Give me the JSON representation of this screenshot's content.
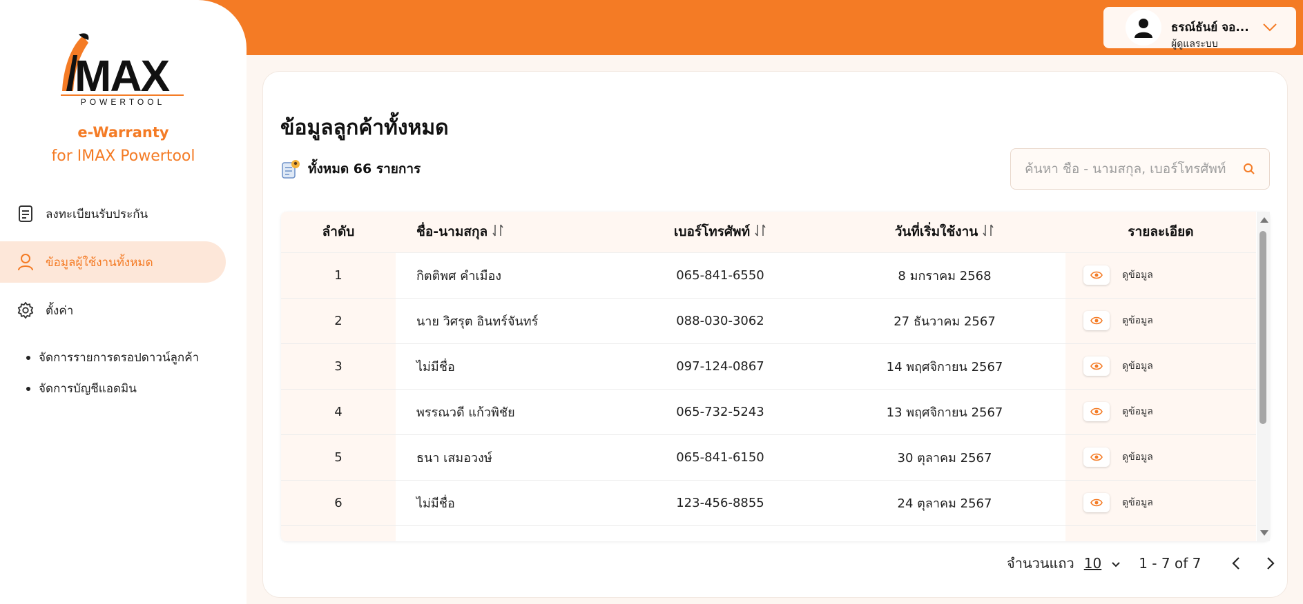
{
  "brand": {
    "logo_text": "IMAX",
    "logo_sub": "POWERTOOL",
    "title": "e-Warranty",
    "subtitle": "for IMAX Powertool"
  },
  "sidebar": {
    "items": [
      {
        "label": "ลงทะเบียนรับประกัน",
        "icon": "document-icon",
        "active": false
      },
      {
        "label": "ข้อมูลผู้ใช้งานทั้งหมด",
        "icon": "user-icon",
        "active": true
      },
      {
        "label": "ตั้งค่า",
        "icon": "gear-icon",
        "active": false
      }
    ],
    "sub_items": [
      "จัดการรายการดรอปดาวน์ลูกค้า",
      "จัดการบัญชีแอดมิน"
    ]
  },
  "user": {
    "name": "ธรณ์ธันย์ จอ...",
    "role": "ผู้ดูแลระบบ"
  },
  "page": {
    "title": "ข้อมูลลูกค้าทั้งหมด",
    "count_text": "ทั้งหมด 66 รายการ"
  },
  "search": {
    "placeholder": "ค้นหา ชื่อ - นามสกุล, เบอร์โทรศัพท์"
  },
  "table": {
    "headers": {
      "index": "ลำดับ",
      "name": "ชื่อ-นามสกุล",
      "phone": "เบอร์โทรศัพท์",
      "date": "วันที่เริ่มใช้งาน",
      "detail": "รายละเอียด"
    },
    "view_label": "ดูข้อมูล",
    "rows": [
      {
        "index": "1",
        "name": "กิตติพศ คำเมือง",
        "phone": "065-841-6550",
        "date": "8 มกราคม 2568"
      },
      {
        "index": "2",
        "name": "นาย วิศรุต อินทร์จันทร์",
        "phone": "088-030-3062",
        "date": "27 ธันวาคม 2567"
      },
      {
        "index": "3",
        "name": "ไม่มีชื่อ",
        "phone": "097-124-0867",
        "date": "14 พฤศจิกายน 2567"
      },
      {
        "index": "4",
        "name": "พรรณวดี แก้วพิชัย",
        "phone": "065-732-5243",
        "date": "13 พฤศจิกายน 2567"
      },
      {
        "index": "5",
        "name": "ธนา เสมอวงษ์",
        "phone": "065-841-6150",
        "date": "30 ตุลาคม 2567"
      },
      {
        "index": "6",
        "name": "ไม่มีชื่อ",
        "phone": "123-456-8855",
        "date": "24 ตุลาคม 2567"
      }
    ]
  },
  "pagination": {
    "rows_label": "จำนวนแถว",
    "rows_value": "10",
    "range": "1 - 7 of 7"
  },
  "colors": {
    "accent": "#f47b25",
    "accent_light": "#fde7d9",
    "header_bg": "#fff7f2"
  }
}
